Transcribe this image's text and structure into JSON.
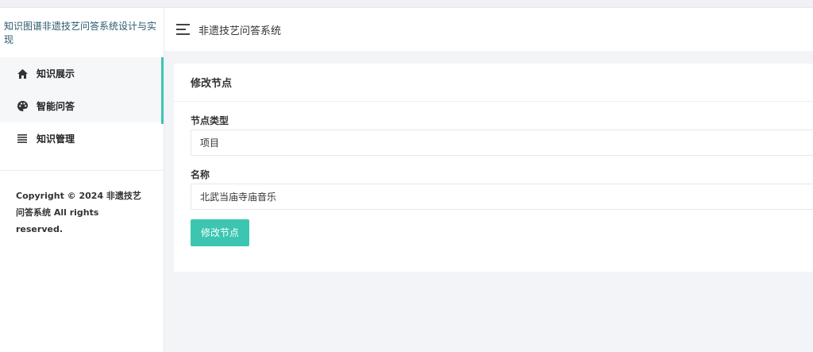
{
  "sidebar": {
    "brand": "知识图谱非遗技艺问答系统设计与实现",
    "items": [
      {
        "label": "知识展示",
        "icon": "home-icon"
      },
      {
        "label": "智能问答",
        "icon": "palette-icon"
      },
      {
        "label": "知识管理",
        "icon": "list-icon"
      }
    ],
    "copyright": "Copyright © 2024 非遗技艺问答系统 All rights reserved."
  },
  "header": {
    "title": "非遗技艺问答系统",
    "menu_icon": "hamburger-icon"
  },
  "card": {
    "title": "修改节点",
    "fields": [
      {
        "label": "节点类型",
        "value": "项目"
      },
      {
        "label": "名称",
        "value": "北武当庙寺庙音乐"
      }
    ],
    "submit_label": "修改节点"
  },
  "colors": {
    "accent": "#3cc6b1",
    "brand_text": "#2c5a70"
  }
}
